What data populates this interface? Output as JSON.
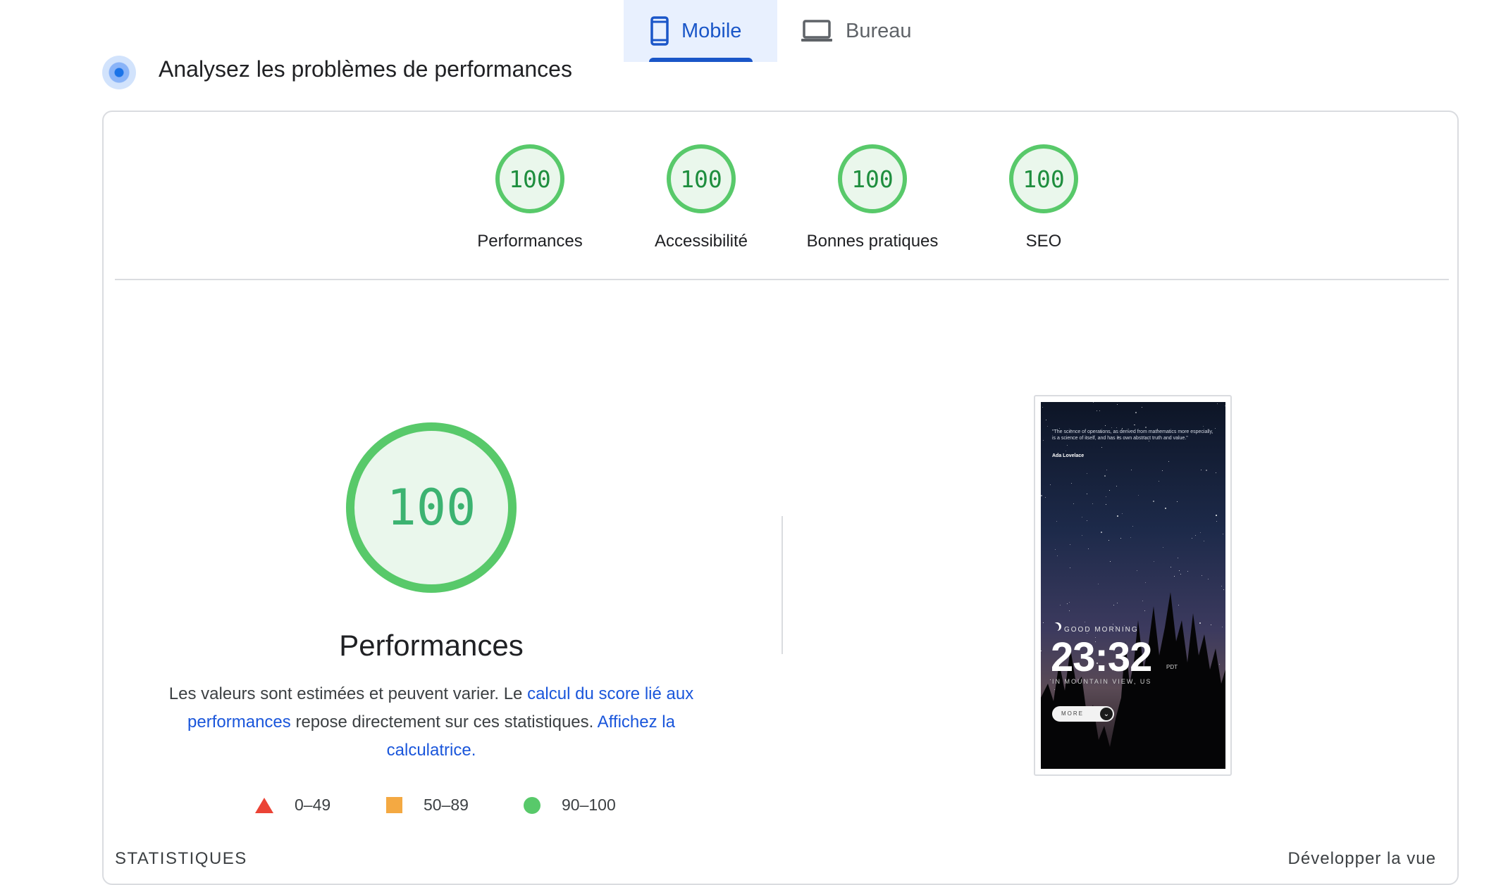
{
  "tabs": [
    {
      "label": "Mobile",
      "icon": "smartphone-icon",
      "selected": true
    },
    {
      "label": "Bureau",
      "icon": "laptop-icon",
      "selected": false
    }
  ],
  "section": {
    "title": "Analysez les problèmes de performances",
    "icon": "pulse-icon"
  },
  "gauges": [
    {
      "score": "100",
      "label": "Performances"
    },
    {
      "score": "100",
      "label": "Accessibilité"
    },
    {
      "score": "100",
      "label": "Bonnes pratiques"
    },
    {
      "score": "100",
      "label": "SEO"
    }
  ],
  "performance": {
    "score": "100",
    "title": "Performances",
    "desc_1": "Les valeurs sont estimées et peuvent varier. Le ",
    "link_score": "calcul du score lié aux performances",
    "desc_2": " repose directement sur ces statistiques. ",
    "link_calc": "Affichez la calculatrice."
  },
  "legend": [
    {
      "range": "0–49",
      "color": "#eb4335",
      "shape": "triangle"
    },
    {
      "range": "50–89",
      "color": "#f4a942",
      "shape": "square"
    },
    {
      "range": "90–100",
      "color": "#58c96a",
      "shape": "circle"
    }
  ],
  "stats_label": "STATISTIQUES",
  "expand_label": "Développer la vue",
  "screenshot": {
    "quote": "\"The science of operations, as derived from mathematics more especially, is a science of itself, and has its own abstract truth and value.\"",
    "author": "Ada Lovelace",
    "greeting": "GOOD MORNING",
    "time": "23:32",
    "timezone": "PDT",
    "location": "IN MOUNTAIN VIEW, US",
    "more": "MORE"
  },
  "colors": {
    "accent": "#1a56c8",
    "pass": "#58c96a",
    "fail": "#eb4335",
    "average": "#f4a942"
  }
}
